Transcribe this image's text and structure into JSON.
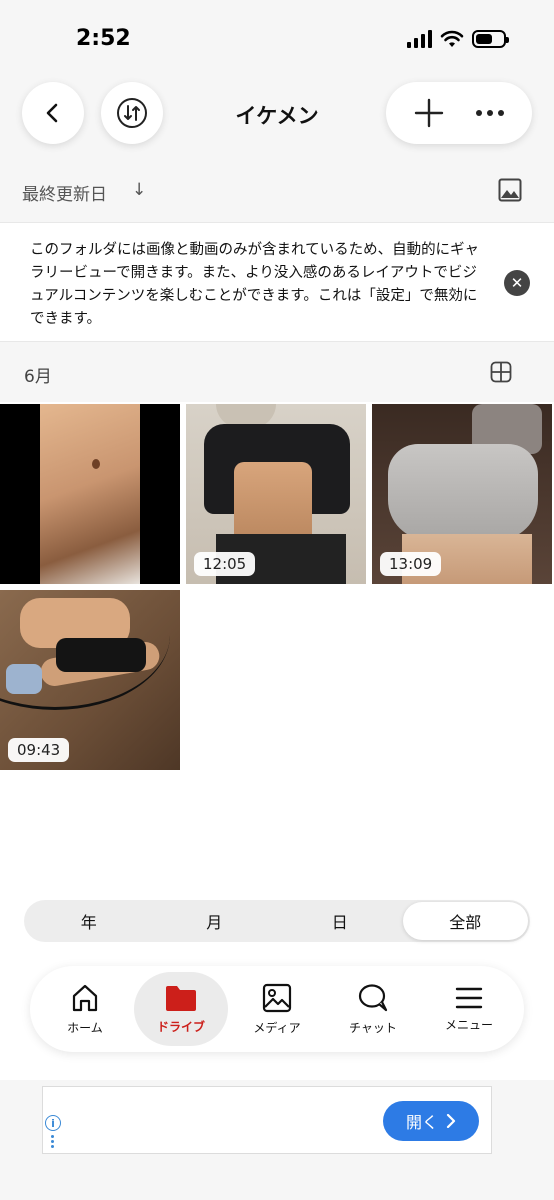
{
  "status_bar": {
    "time": "2:52"
  },
  "header": {
    "title": "イケメン"
  },
  "sort": {
    "label": "最終更新日",
    "direction_symbol": "↓"
  },
  "banner": {
    "text": "このフォルダには画像と動画のみが含まれているため、自動的にギャラリービューで開きます。また、より没入感のあるレイアウトでビジュアルコンテンツを楽しむことができます。これは「設定」で無効にできます。",
    "close_symbol": "✕"
  },
  "month": {
    "label": "6月"
  },
  "media": [
    {
      "type": "photo",
      "duration": ""
    },
    {
      "type": "video",
      "duration": "12:05"
    },
    {
      "type": "video",
      "duration": "13:09"
    },
    {
      "type": "video",
      "duration": "09:43"
    }
  ],
  "segments": [
    "年",
    "月",
    "日",
    "全部"
  ],
  "selected_segment": "全部",
  "nav": [
    {
      "label": "ホーム",
      "icon": "home-icon"
    },
    {
      "label": "ドライブ",
      "icon": "folder-icon"
    },
    {
      "label": "メディア",
      "icon": "image-icon"
    },
    {
      "label": "チャット",
      "icon": "chat-icon"
    },
    {
      "label": "メニュー",
      "icon": "menu-icon"
    }
  ],
  "active_nav": "ドライブ",
  "ad": {
    "open_label": "開く",
    "info_symbol": "i"
  },
  "colors": {
    "accent_red": "#cc1f1a",
    "ad_blue": "#2d7be5"
  }
}
